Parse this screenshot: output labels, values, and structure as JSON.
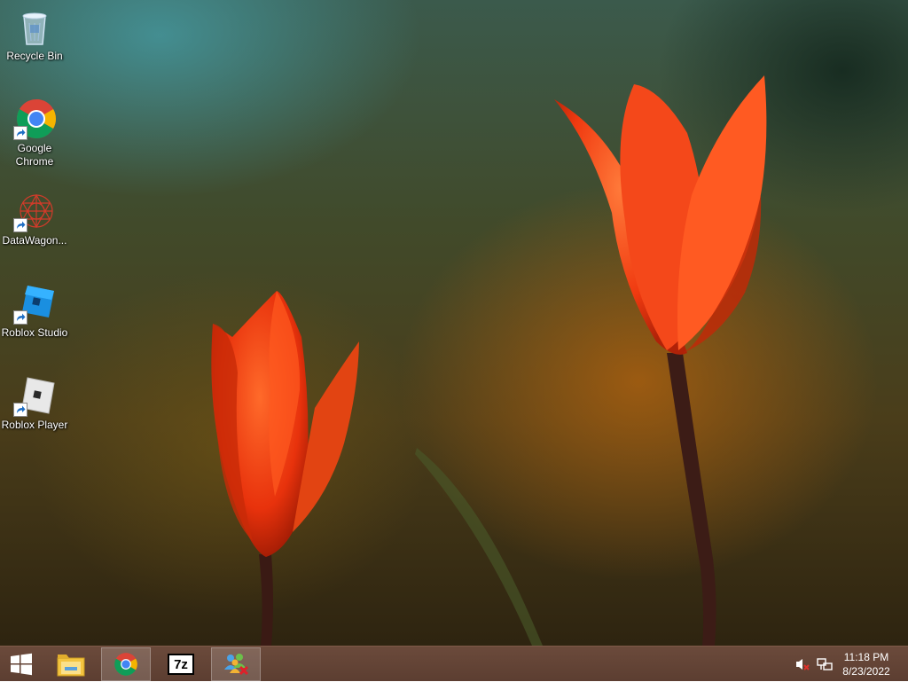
{
  "desktop": {
    "icons": [
      {
        "label": "Recycle Bin",
        "icon": "recycle-bin-icon"
      },
      {
        "label": "Google Chrome",
        "icon": "chrome-icon"
      },
      {
        "label": "DataWagon...",
        "icon": "datawagon-icon"
      },
      {
        "label": "Roblox Studio",
        "icon": "roblox-studio-icon"
      },
      {
        "label": "Roblox Player",
        "icon": "roblox-player-icon"
      }
    ]
  },
  "taskbar": {
    "start_icon": "windows-logo-icon",
    "pinned": [
      {
        "icon": "file-explorer-icon",
        "running": false
      },
      {
        "icon": "chrome-icon",
        "running": true
      },
      {
        "icon": "7zip-icon",
        "running": false,
        "text": "7z"
      },
      {
        "icon": "network-people-icon",
        "running": true
      }
    ],
    "tray": {
      "volume_icon": "volume-muted-icon",
      "network_icon": "network-icon"
    },
    "clock": {
      "time": "11:18 PM",
      "date": "8/23/2022"
    },
    "colors": {
      "taskbar": "#5c3e31",
      "running_highlight": "#8a6a5c"
    }
  }
}
